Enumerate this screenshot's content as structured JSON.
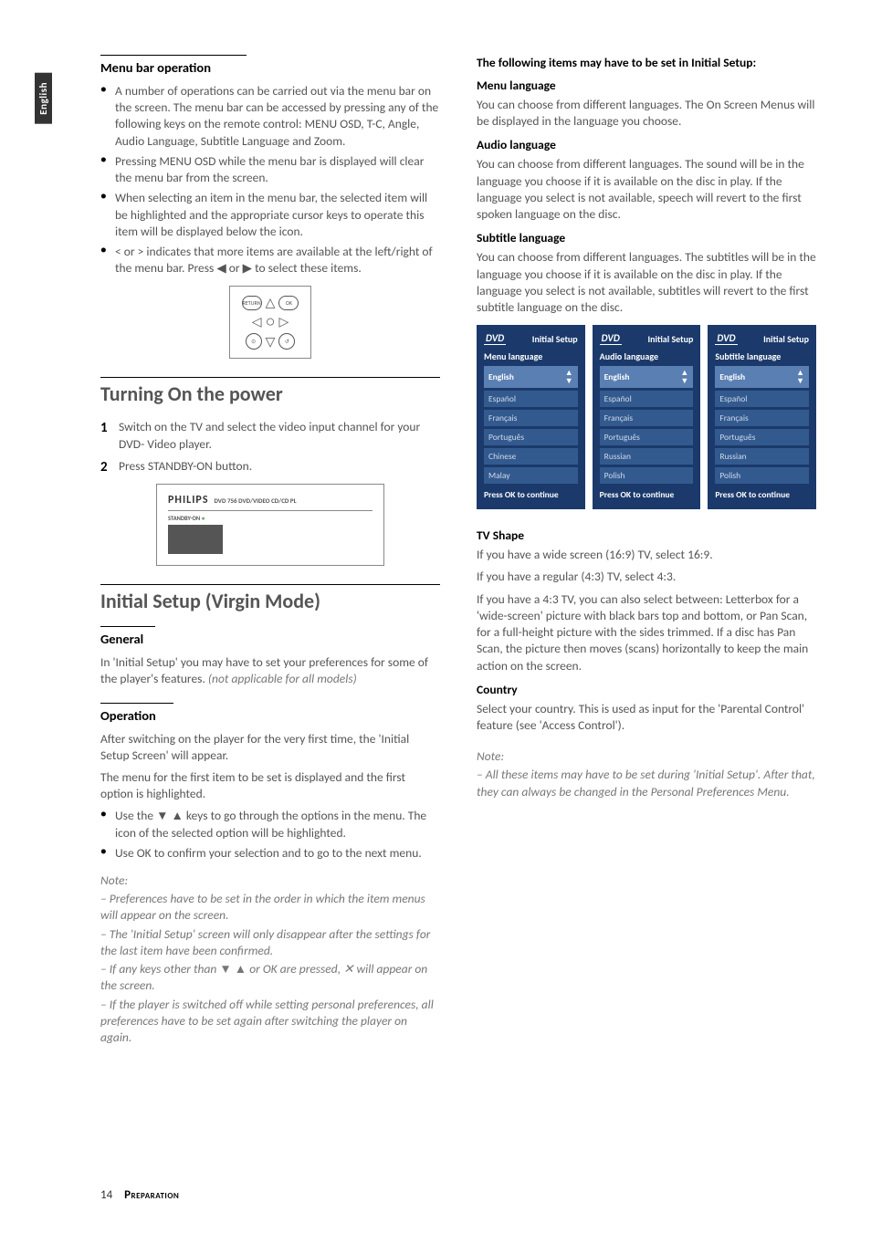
{
  "tab": "English",
  "left": {
    "menubar": {
      "heading": "Menu bar operation",
      "bullets": [
        "A number of operations can be carried out via the menu bar on the screen. The menu bar can be accessed by pressing any of the following keys on the remote control: MENU OSD, T-C, Angle, Audio Language, Subtitle Language and Zoom.",
        "Pressing MENU OSD while the menu bar is displayed will clear the menu bar from the screen.",
        "When selecting an item in the menu bar, the selected item will be highlighted and the appropriate cursor keys to operate this item will be displayed below the icon.",
        "< or > indicates that more items are available at the left/right of the menu bar. Press ◀ or ▶ to select these items."
      ],
      "remote_btns": {
        "return": "RETURN",
        "ok": "OK"
      }
    },
    "power": {
      "heading": "Turning On the power",
      "steps": [
        "Switch on the TV and select the video input channel for your DVD- Video player.",
        "Press STANDBY-ON button."
      ],
      "player": {
        "brand": "PHILIPS",
        "model": "DVD 756  DVD/VIDEO CD/CD PL",
        "standby": "STANDBY-ON"
      }
    },
    "setup": {
      "heading": "Initial Setup (Virgin Mode)",
      "general_h": "General",
      "general_text": "In 'Initial Setup' you may have to set your preferences for some of the player's features. ",
      "general_note": "(not applicable for all models)",
      "operation_h": "Operation",
      "op_para1": "After switching on the player for the very first time, the 'Initial Setup Screen' will appear.",
      "op_para2": "The menu for the first item to be set is displayed and the first option is highlighted.",
      "op_bullets": [
        "Use the ▼ ▲ keys to go through the options in the menu. The icon of the selected option will be highlighted.",
        "Use OK to confirm your selection and to go to the next menu."
      ],
      "note_label": "Note:",
      "notes": [
        "–   Preferences have to be set in the order in which the item menus will appear on the screen.",
        "–   The 'Initial Setup' screen will only disappear after the settings for the last item have been confirmed.",
        "–   If any keys other than ▼ ▲ or OK are pressed, ✕ will appear on the screen.",
        "–   If the player is switched off while setting personal preferences, all preferences have to be set again after switching the player on again."
      ]
    }
  },
  "right": {
    "intro": "The following items may have to be set in Initial Setup:",
    "menu_lang_h": "Menu language",
    "menu_lang_p": "You can choose from different languages. The On Screen Menus will be displayed in the language you choose.",
    "audio_lang_h": "Audio language",
    "audio_lang_p": "You can choose from different languages. The sound will be in the language you choose if it is available on the disc in play. If the language you select is not available, speech will revert to the first spoken language on the disc.",
    "sub_lang_h": "Subtitle language",
    "sub_lang_p": "You can choose from different languages. The subtitles will be in the language you choose if it is available on the disc in play. If the language you select is not available, subtitles will revert to the first subtitle language on the disc.",
    "osd": {
      "dvd": "DVD",
      "title": "Initial Setup",
      "footer": "Press OK to continue",
      "menus": [
        {
          "sub": "Menu language",
          "items": [
            "English",
            "Español",
            "Français",
            "Português",
            "Chinese",
            "Malay"
          ]
        },
        {
          "sub": "Audio language",
          "items": [
            "English",
            "Español",
            "Français",
            "Português",
            "Russian",
            "Polish"
          ]
        },
        {
          "sub": "Subtitle language",
          "items": [
            "English",
            "Español",
            "Français",
            "Português",
            "Russian",
            "Polish"
          ]
        }
      ]
    },
    "tvshape_h": "TV Shape",
    "tvshape_p1": "If you have a wide screen (16:9) TV, select 16:9.",
    "tvshape_p2": "If you have a regular (4:3) TV, select 4:3.",
    "tvshape_p3": "If you have a 4:3 TV, you can also select between: Letterbox for a 'wide-screen' picture with black bars top and bottom, or Pan Scan, for a full-height picture with the sides trimmed. If a disc has Pan Scan, the picture then moves (scans) horizontally to keep the main action on the screen.",
    "country_h": "Country",
    "country_p": "Select your country. This is used as input for the 'Parental Control' feature (see 'Access Control').",
    "note_label": "Note:",
    "note_text": "–   All these items may have to be set during 'Initial Setup'. After that, they can always be changed in the Personal Preferences Menu."
  },
  "footer": {
    "page": "14",
    "section": "Preparation"
  }
}
